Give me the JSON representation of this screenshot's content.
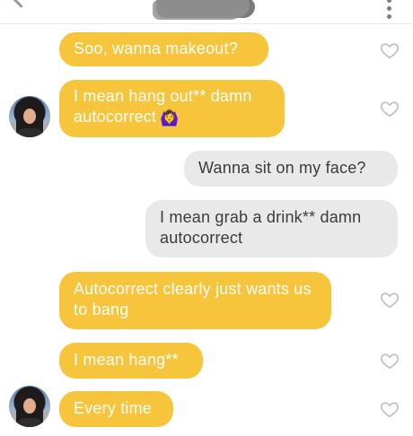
{
  "messages": [
    {
      "text": "Soo, wanna makeout?",
      "sender": "them",
      "heart": true
    },
    {
      "text": "I mean hang out** damn autocorrect",
      "emoji": "🙆‍♀️",
      "sender": "them",
      "heart": true,
      "avatar": true
    },
    {
      "text": "Wanna sit on my face?",
      "sender": "me"
    },
    {
      "text": "I mean grab a drink** damn autocorrect",
      "sender": "me"
    },
    {
      "text": "Autocorrect clearly just wants us to bang",
      "sender": "them",
      "heart": true
    },
    {
      "text": "I mean hang**",
      "sender": "them",
      "heart": true
    },
    {
      "text": "Every time",
      "sender": "them",
      "heart": true,
      "avatar": true
    }
  ],
  "colors": {
    "them_bubble": "#f7c53c",
    "me_bubble": "#e9e9e9",
    "heart_stroke": "#bdbdbd"
  },
  "icons": {
    "back": "chevron-left-icon",
    "menu": "kebab-menu-icon",
    "like": "heart-outline-icon"
  }
}
